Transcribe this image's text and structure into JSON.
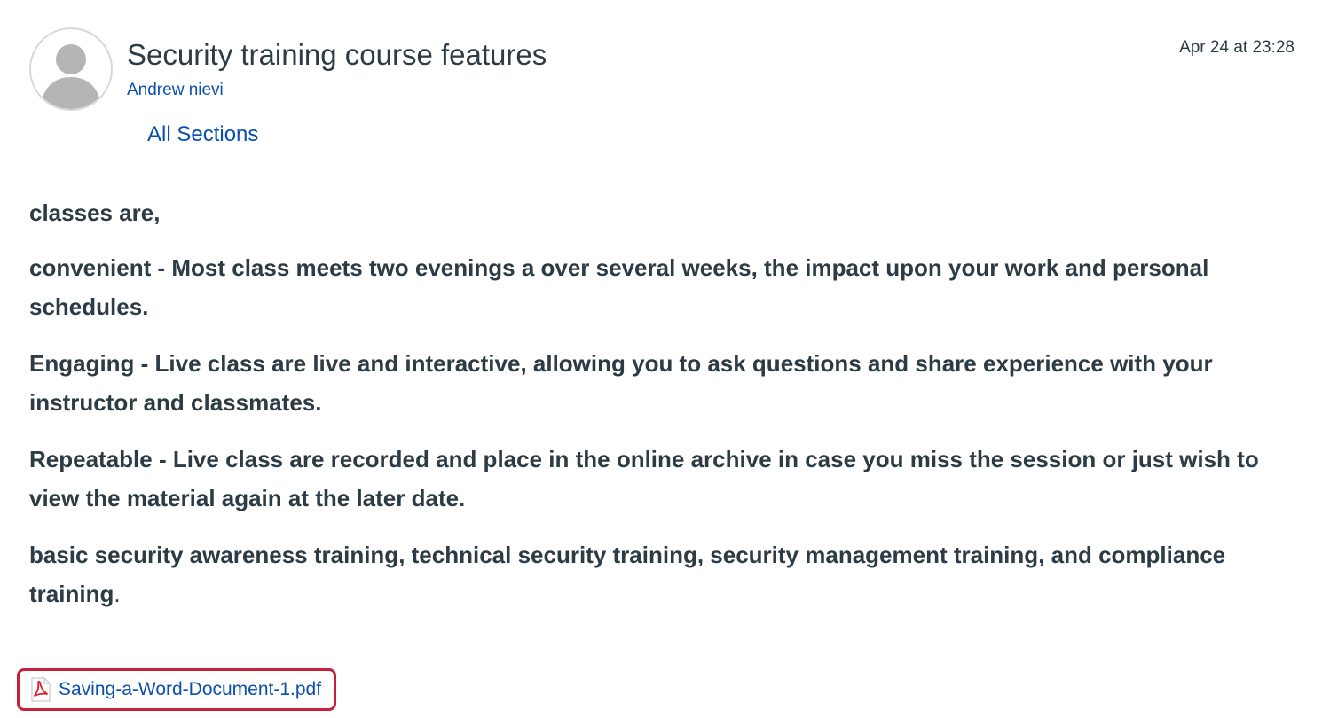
{
  "post": {
    "title": "Security training course features",
    "author": "Andrew nievi",
    "timestamp": "Apr 24 at 23:28",
    "sections_link": "All Sections",
    "paragraphs": [
      "classes are,",
      "convenient - Most class meets two evenings a over several weeks,  the impact upon your work and personal schedules.",
      "Engaging - Live class are live and interactive, allowing you to ask questions and share experience with your instructor and classmates.",
      "Repeatable - Live class are recorded and place in the online archive in case you miss the session or just wish to view the material again at the later date.",
      "basic security awareness training, technical security training, security management training, and compliance training"
    ],
    "final_punctuation": ".",
    "attachment": {
      "filename": "Saving-a-Word-Document-1.pdf",
      "icon": "pdf-file-icon"
    }
  },
  "colors": {
    "link": "#0b4fb0",
    "text": "#2d3b45",
    "highlight_border": "#c6203a",
    "avatar_gray": "#b5b5b5"
  }
}
